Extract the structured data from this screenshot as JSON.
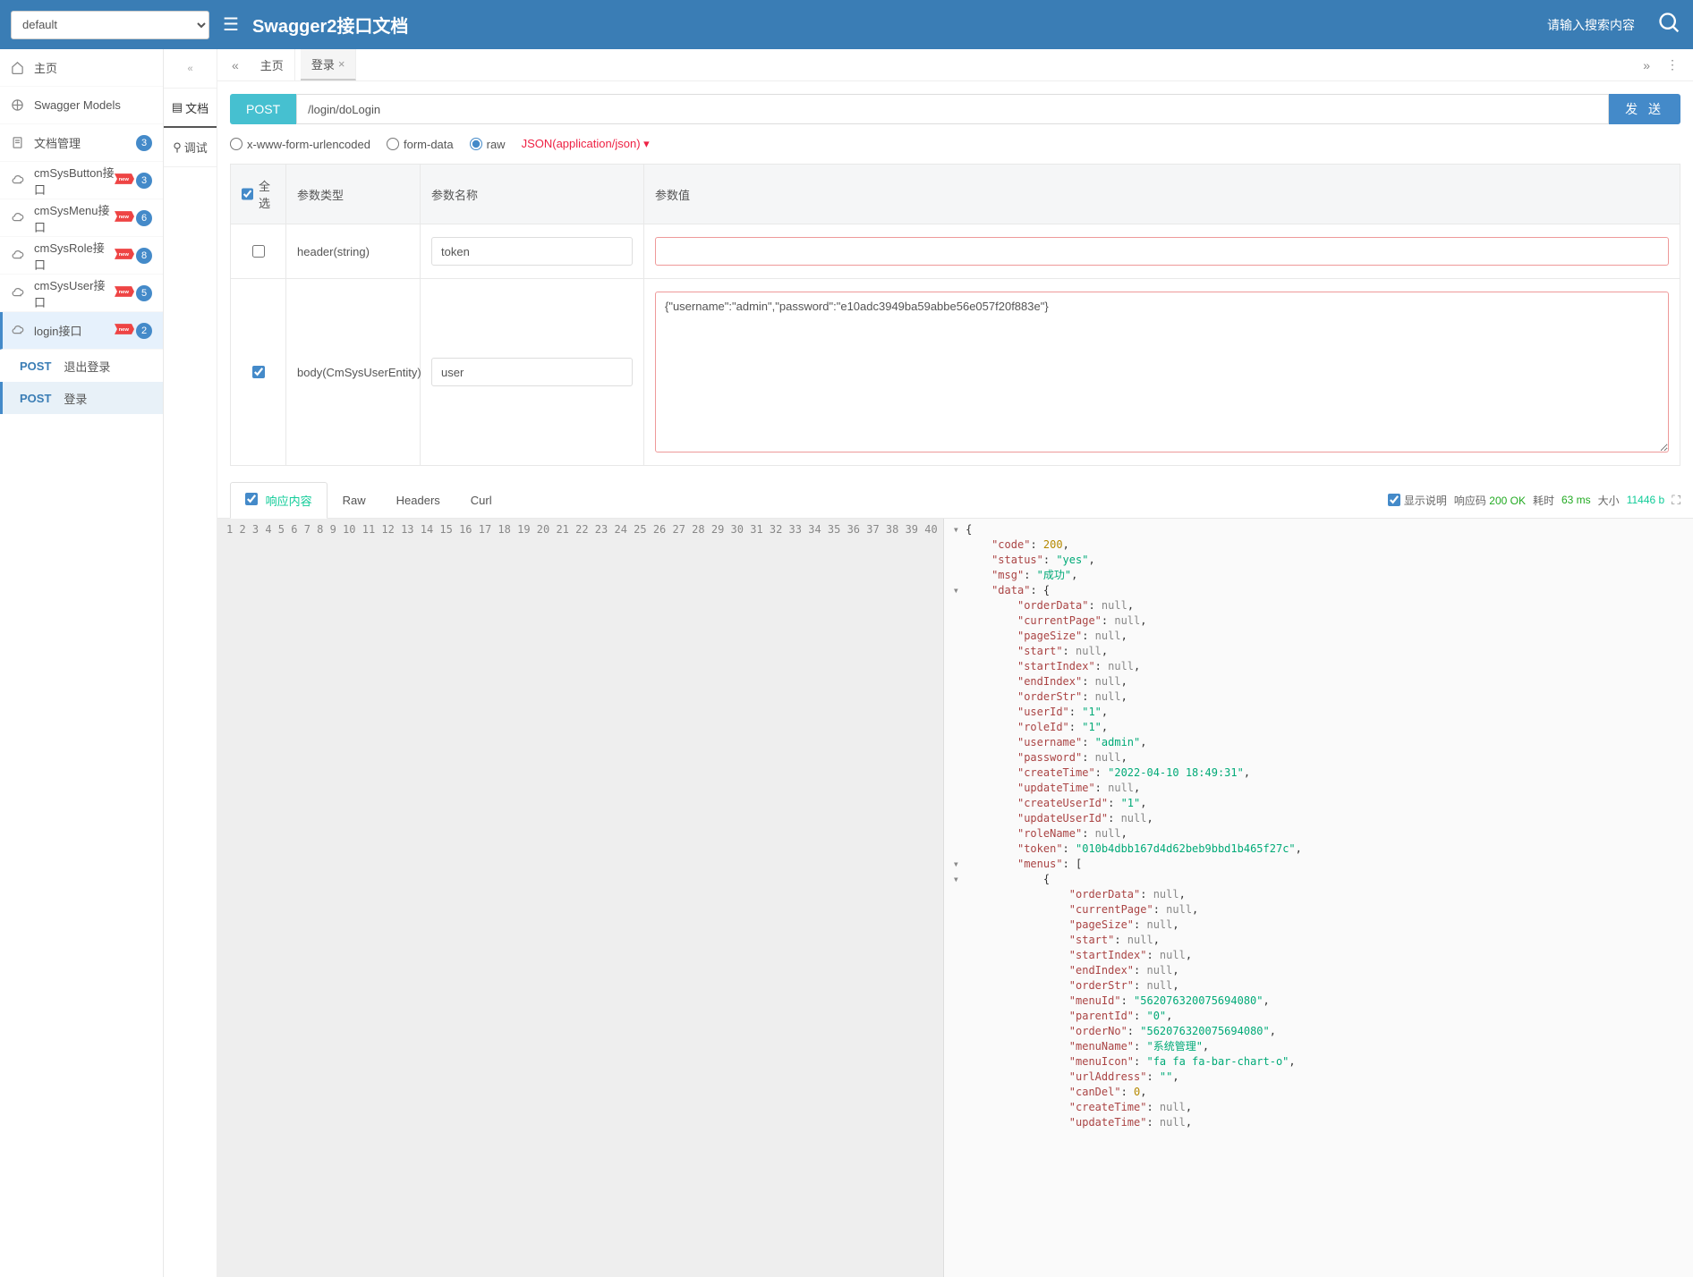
{
  "header": {
    "group_select": "default",
    "title": "Swagger2接口文档",
    "search_placeholder": "请输入搜索内容"
  },
  "sidebar": {
    "items": [
      {
        "icon": "home",
        "label": "主页",
        "badge": null,
        "new": false
      },
      {
        "icon": "cube",
        "label": "Swagger Models",
        "badge": null,
        "new": false
      },
      {
        "icon": "doc",
        "label": "文档管理",
        "badge": "3",
        "new": false
      },
      {
        "icon": "cloud",
        "label": "cmSysButton接口",
        "badge": "3",
        "new": true
      },
      {
        "icon": "cloud",
        "label": "cmSysMenu接口",
        "badge": "6",
        "new": true
      },
      {
        "icon": "cloud",
        "label": "cmSysRole接口",
        "badge": "8",
        "new": true
      },
      {
        "icon": "cloud",
        "label": "cmSysUser接口",
        "badge": "5",
        "new": true
      },
      {
        "icon": "cloud",
        "label": "login接口",
        "badge": "2",
        "new": true,
        "active": true
      }
    ],
    "subitems": [
      {
        "method": "POST",
        "label": "退出登录",
        "active": false
      },
      {
        "method": "POST",
        "label": "登录",
        "active": true
      }
    ]
  },
  "left_tabs": {
    "doc": "文档",
    "debug": "调试"
  },
  "top_tabs": {
    "home": "主页",
    "login": "登录"
  },
  "request": {
    "method": "POST",
    "url": "/login/doLogin",
    "send": "发 送",
    "body_types": {
      "form": "x-www-form-urlencoded",
      "formdata": "form-data",
      "raw": "raw"
    },
    "json_type": "JSON(application/json)"
  },
  "params_table": {
    "head": {
      "select_all": "全选",
      "type": "参数类型",
      "name": "参数名称",
      "value": "参数值"
    },
    "rows": [
      {
        "checked": false,
        "type": "header(string)",
        "name": "token",
        "value": "",
        "textarea": false
      },
      {
        "checked": true,
        "type": "body(CmSysUserEntity)",
        "name": "user",
        "value": "{\"username\":\"admin\",\"password\":\"e10adc3949ba59abbe56e057f20f883e\"}",
        "textarea": true
      }
    ]
  },
  "response": {
    "tabs": {
      "content": "响应内容",
      "raw": "Raw",
      "headers": "Headers",
      "curl": "Curl"
    },
    "meta": {
      "show_desc": "显示说明",
      "code_lbl": "响应码",
      "code": "200 OK",
      "time_lbl": "耗时",
      "time": "63 ms",
      "size_lbl": "大小",
      "size": "11446 b"
    }
  },
  "json_lines": [
    {
      "n": 1,
      "t": "{",
      "fold": true
    },
    {
      "n": 2,
      "t": "    \"code\": 200,",
      "keys": [
        "code"
      ],
      "nums": [
        "200"
      ]
    },
    {
      "n": 3,
      "t": "    \"status\": \"yes\",",
      "keys": [
        "status"
      ],
      "strs": [
        "yes"
      ]
    },
    {
      "n": 4,
      "t": "    \"msg\": \"成功\",",
      "keys": [
        "msg"
      ],
      "strs": [
        "成功"
      ]
    },
    {
      "n": 5,
      "t": "    \"data\": {",
      "keys": [
        "data"
      ],
      "fold": true
    },
    {
      "n": 6,
      "t": "        \"orderData\": null,",
      "keys": [
        "orderData"
      ],
      "nulls": true
    },
    {
      "n": 7,
      "t": "        \"currentPage\": null,",
      "keys": [
        "currentPage"
      ],
      "nulls": true
    },
    {
      "n": 8,
      "t": "        \"pageSize\": null,",
      "keys": [
        "pageSize"
      ],
      "nulls": true
    },
    {
      "n": 9,
      "t": "        \"start\": null,",
      "keys": [
        "start"
      ],
      "nulls": true
    },
    {
      "n": 10,
      "t": "        \"startIndex\": null,",
      "keys": [
        "startIndex"
      ],
      "nulls": true
    },
    {
      "n": 11,
      "t": "        \"endIndex\": null,",
      "keys": [
        "endIndex"
      ],
      "nulls": true
    },
    {
      "n": 12,
      "t": "        \"orderStr\": null,",
      "keys": [
        "orderStr"
      ],
      "nulls": true
    },
    {
      "n": 13,
      "t": "        \"userId\": \"1\",",
      "keys": [
        "userId"
      ],
      "strs": [
        "1"
      ]
    },
    {
      "n": 14,
      "t": "        \"roleId\": \"1\",",
      "keys": [
        "roleId"
      ],
      "strs": [
        "1"
      ]
    },
    {
      "n": 15,
      "t": "        \"username\": \"admin\",",
      "keys": [
        "username"
      ],
      "strs": [
        "admin"
      ]
    },
    {
      "n": 16,
      "t": "        \"password\": null,",
      "keys": [
        "password"
      ],
      "nulls": true
    },
    {
      "n": 17,
      "t": "        \"createTime\": \"2022-04-10 18:49:31\",",
      "keys": [
        "createTime"
      ],
      "strs": [
        "2022-04-10 18:49:31"
      ]
    },
    {
      "n": 18,
      "t": "        \"updateTime\": null,",
      "keys": [
        "updateTime"
      ],
      "nulls": true
    },
    {
      "n": 19,
      "t": "        \"createUserId\": \"1\",",
      "keys": [
        "createUserId"
      ],
      "strs": [
        "1"
      ]
    },
    {
      "n": 20,
      "t": "        \"updateUserId\": null,",
      "keys": [
        "updateUserId"
      ],
      "nulls": true
    },
    {
      "n": 21,
      "t": "        \"roleName\": null,",
      "keys": [
        "roleName"
      ],
      "nulls": true
    },
    {
      "n": 22,
      "t": "        \"token\": \"010b4dbb167d4d62beb9bbd1b465f27c\",",
      "keys": [
        "token"
      ],
      "strs": [
        "010b4dbb167d4d62beb9bbd1b465f27c"
      ]
    },
    {
      "n": 23,
      "t": "        \"menus\": [",
      "keys": [
        "menus"
      ],
      "fold": true
    },
    {
      "n": 24,
      "t": "            {",
      "fold": true
    },
    {
      "n": 25,
      "t": "                \"orderData\": null,",
      "keys": [
        "orderData"
      ],
      "nulls": true
    },
    {
      "n": 26,
      "t": "                \"currentPage\": null,",
      "keys": [
        "currentPage"
      ],
      "nulls": true
    },
    {
      "n": 27,
      "t": "                \"pageSize\": null,",
      "keys": [
        "pageSize"
      ],
      "nulls": true
    },
    {
      "n": 28,
      "t": "                \"start\": null,",
      "keys": [
        "start"
      ],
      "nulls": true
    },
    {
      "n": 29,
      "t": "                \"startIndex\": null,",
      "keys": [
        "startIndex"
      ],
      "nulls": true
    },
    {
      "n": 30,
      "t": "                \"endIndex\": null,",
      "keys": [
        "endIndex"
      ],
      "nulls": true
    },
    {
      "n": 31,
      "t": "                \"orderStr\": null,",
      "keys": [
        "orderStr"
      ],
      "nulls": true
    },
    {
      "n": 32,
      "t": "                \"menuId\": \"562076320075694080\",",
      "keys": [
        "menuId"
      ],
      "strs": [
        "562076320075694080"
      ]
    },
    {
      "n": 33,
      "t": "                \"parentId\": \"0\",",
      "keys": [
        "parentId"
      ],
      "strs": [
        "0"
      ]
    },
    {
      "n": 34,
      "t": "                \"orderNo\": \"562076320075694080\",",
      "keys": [
        "orderNo"
      ],
      "strs": [
        "562076320075694080"
      ]
    },
    {
      "n": 35,
      "t": "                \"menuName\": \"系统管理\",",
      "keys": [
        "menuName"
      ],
      "strs": [
        "系统管理"
      ]
    },
    {
      "n": 36,
      "t": "                \"menuIcon\": \"fa fa fa-bar-chart-o\",",
      "keys": [
        "menuIcon"
      ],
      "strs": [
        "fa fa fa-bar-chart-o"
      ]
    },
    {
      "n": 37,
      "t": "                \"urlAddress\": \"\",",
      "keys": [
        "urlAddress"
      ],
      "strs": [
        ""
      ]
    },
    {
      "n": 38,
      "t": "                \"canDel\": 0,",
      "keys": [
        "canDel"
      ],
      "nums": [
        "0"
      ]
    },
    {
      "n": 39,
      "t": "                \"createTime\": null,",
      "keys": [
        "createTime"
      ],
      "nulls": true
    },
    {
      "n": 40,
      "t": "                \"updateTime\": null,",
      "keys": [
        "updateTime"
      ],
      "nulls": true
    }
  ]
}
